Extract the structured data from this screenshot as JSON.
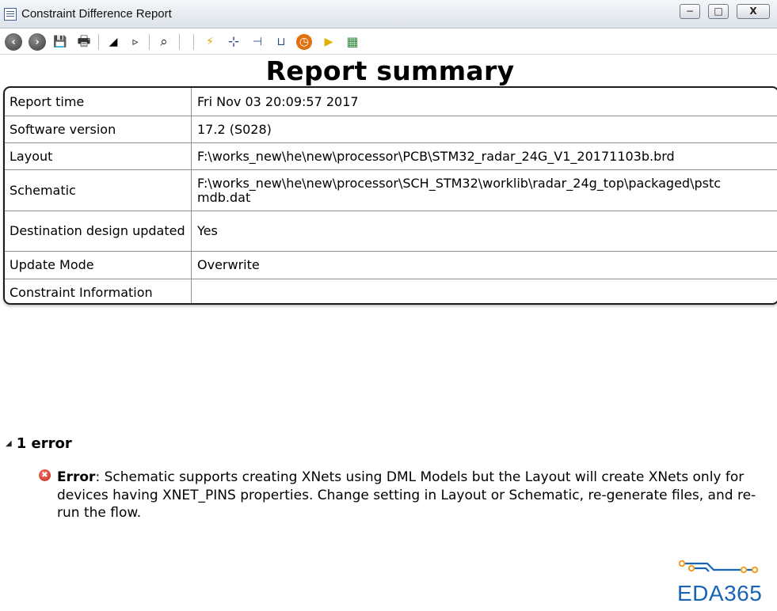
{
  "window": {
    "title": "Constraint Difference Report",
    "controls": {
      "minimize": "−",
      "maximize": "□",
      "close": "X"
    }
  },
  "toolbar": {
    "buttons": [
      {
        "name": "back-icon",
        "glyph": "‹"
      },
      {
        "name": "forward-icon",
        "glyph": "›"
      },
      {
        "name": "save-icon",
        "glyph": "💾"
      },
      {
        "name": "print-icon",
        "glyph": "🖶"
      },
      {
        "name": "collapse-all-icon",
        "glyph": "◢"
      },
      {
        "name": "expand-icon",
        "glyph": "▹"
      },
      {
        "name": "find-icon",
        "glyph": "⌕"
      },
      {
        "name": "lightning-icon",
        "glyph": "⚡"
      },
      {
        "name": "net-tie-icon",
        "glyph": "⊹"
      },
      {
        "name": "spacing-icon",
        "glyph": "⊣"
      },
      {
        "name": "same-net-icon",
        "glyph": "⊔"
      },
      {
        "name": "timing-icon",
        "glyph": "◷"
      },
      {
        "name": "property-tag-icon",
        "glyph": "▶"
      },
      {
        "name": "topology-icon",
        "glyph": "▦"
      }
    ]
  },
  "report": {
    "title": "Report summary",
    "rows": [
      {
        "label": "Report time",
        "value": "Fri Nov 03 20:09:57 2017"
      },
      {
        "label": "Software version",
        "value": "17.2 (S028)"
      },
      {
        "label": "Layout",
        "value": "F:\\works_new\\he\\new\\processor\\PCB\\STM32_radar_24G_V1_20171103b.brd"
      },
      {
        "label": "Schematic",
        "value": "F:\\works_new\\he\\new\\processor\\SCH_STM32\\worklib\\radar_24g_top\\packaged\\pstcmdb.dat"
      },
      {
        "label": "Destination design updated",
        "value": "Yes"
      },
      {
        "label": "Update Mode",
        "value": "Overwrite"
      },
      {
        "label": "Constraint Information",
        "value": ""
      }
    ]
  },
  "errors": {
    "heading": "1 error",
    "items": [
      {
        "prefix": "Error",
        "message": ": Schematic supports creating XNets using DML Models but the Layout will create XNets only for devices having XNET_PINS properties. Change setting in Layout or Schematic, re-generate files, and re-run the flow."
      }
    ]
  },
  "watermark": {
    "text": "EDA365"
  },
  "colors": {
    "logo_blue": "#1a64b8",
    "logo_orange": "#f0a020",
    "error_red": "#c2261a"
  }
}
